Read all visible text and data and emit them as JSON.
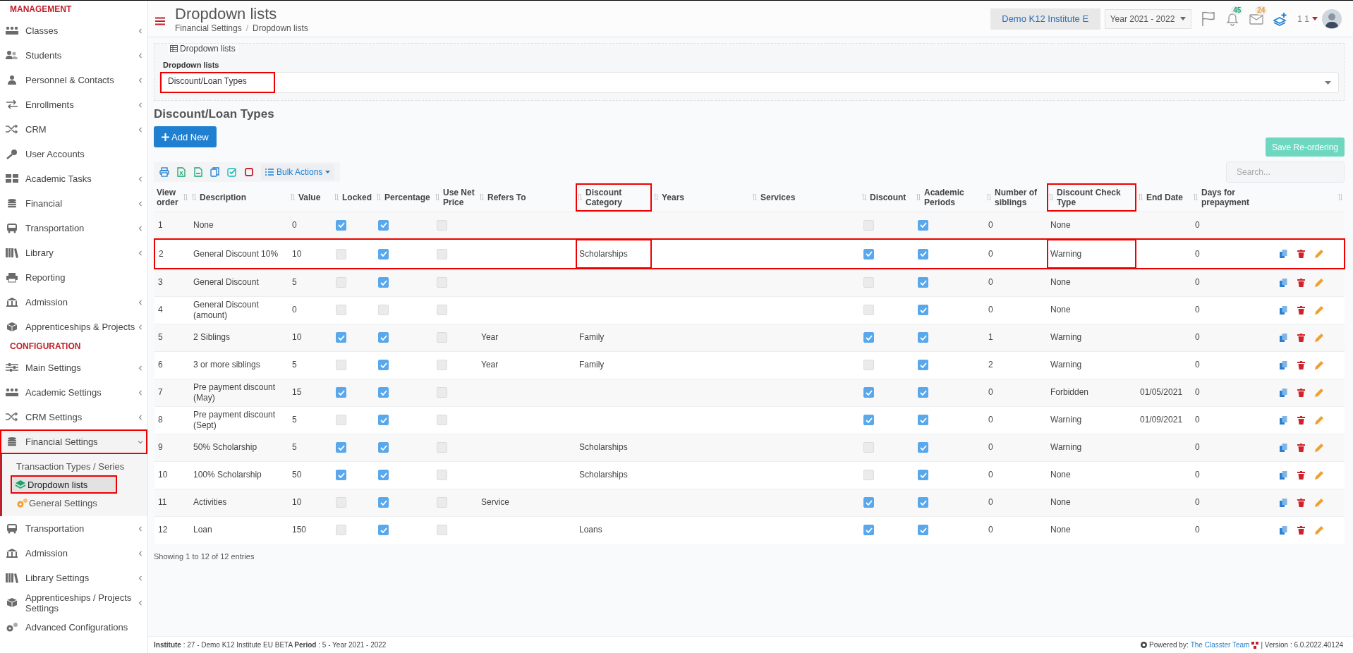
{
  "sidebar": {
    "sections": [
      {
        "heading": "MANAGEMENT",
        "items": [
          {
            "label": "Classes",
            "chevron": true,
            "expanded": false,
            "highlighted": false
          },
          {
            "label": "Students",
            "chevron": true,
            "expanded": false,
            "highlighted": false
          },
          {
            "label": "Personnel & Contacts",
            "chevron": true,
            "expanded": false,
            "highlighted": false
          },
          {
            "label": "Enrollments",
            "chevron": true,
            "expanded": false,
            "highlighted": false
          },
          {
            "label": "CRM",
            "chevron": true,
            "expanded": false,
            "highlighted": false
          },
          {
            "label": "User Accounts",
            "chevron": false,
            "expanded": false,
            "highlighted": false
          },
          {
            "label": "Academic Tasks",
            "chevron": true,
            "expanded": false,
            "highlighted": false
          },
          {
            "label": "Financial",
            "chevron": true,
            "expanded": false,
            "highlighted": false
          },
          {
            "label": "Transportation",
            "chevron": true,
            "expanded": false,
            "highlighted": false
          },
          {
            "label": "Library",
            "chevron": true,
            "expanded": false,
            "highlighted": false
          },
          {
            "label": "Reporting",
            "chevron": false,
            "expanded": false,
            "highlighted": false
          },
          {
            "label": "Admission",
            "chevron": true,
            "expanded": false,
            "highlighted": false
          },
          {
            "label": "Apprenticeships & Projects",
            "chevron": true,
            "expanded": false,
            "highlighted": false
          }
        ]
      },
      {
        "heading": "CONFIGURATION",
        "items": [
          {
            "label": "Main Settings",
            "chevron": true,
            "expanded": false,
            "highlighted": false
          },
          {
            "label": "Academic Settings",
            "chevron": true,
            "expanded": false,
            "highlighted": false
          },
          {
            "label": "CRM Settings",
            "chevron": true,
            "expanded": false,
            "highlighted": false
          },
          {
            "label": "Financial Settings",
            "chevron": true,
            "expanded": true,
            "highlighted": true,
            "children": [
              {
                "label": "Transaction Types / Series",
                "selected": false,
                "highlighted": false
              },
              {
                "label": "Dropdown lists",
                "selected": true,
                "highlighted": true
              },
              {
                "label": "General Settings",
                "selected": false,
                "highlighted": false
              }
            ]
          },
          {
            "label": "Transportation",
            "chevron": true,
            "expanded": false,
            "highlighted": false
          },
          {
            "label": "Admission",
            "chevron": true,
            "expanded": false,
            "highlighted": false
          },
          {
            "label": "Library Settings",
            "chevron": true,
            "expanded": false,
            "highlighted": false
          },
          {
            "label": "Apprenticeships / Projects Settings",
            "chevron": true,
            "expanded": false,
            "highlighted": false
          },
          {
            "label": "Advanced Configurations",
            "chevron": false,
            "expanded": false,
            "highlighted": false
          }
        ]
      }
    ]
  },
  "header": {
    "title": "Dropdown lists",
    "breadcrumb": [
      "Financial Settings",
      "Dropdown lists"
    ],
    "breadcrumb_separator": "/",
    "institute": "Demo K12 Institute E",
    "year": "Year 2021 - 2022",
    "notifications_badge": "45",
    "messages_badge": "24",
    "user": "1 1"
  },
  "panel": {
    "legend": "Dropdown lists",
    "field_label": "Dropdown lists",
    "field_value": "Discount/Loan Types",
    "field_highlighted": true
  },
  "section_title": "Discount/Loan Types",
  "add_button": "Add New",
  "save_button": "Save Re-ordering",
  "bulk_actions": "Bulk Actions",
  "search": {
    "placeholder": "Search..."
  },
  "table": {
    "columns": [
      {
        "label": "View order",
        "highlighted": false
      },
      {
        "label": "Description",
        "highlighted": false
      },
      {
        "label": "Value",
        "highlighted": false
      },
      {
        "label": "Locked",
        "highlighted": false
      },
      {
        "label": "Percentage",
        "highlighted": false
      },
      {
        "label": "Use Net Price",
        "highlighted": false
      },
      {
        "label": "Refers To",
        "highlighted": false
      },
      {
        "label": "Discount Category",
        "highlighted": true
      },
      {
        "label": "Years",
        "highlighted": false
      },
      {
        "label": "Services",
        "highlighted": false
      },
      {
        "label": "Discount",
        "highlighted": false
      },
      {
        "label": "Academic Periods",
        "highlighted": false
      },
      {
        "label": "Number of siblings",
        "highlighted": false
      },
      {
        "label": "Discount Check Type",
        "highlighted": true
      },
      {
        "label": "End Date",
        "highlighted": false
      },
      {
        "label": "Days for prepayment",
        "highlighted": false
      }
    ],
    "rows": [
      {
        "order": "1",
        "description": "None",
        "value": "0",
        "locked": true,
        "percentage": true,
        "use_net_price": false,
        "refers_to": "",
        "category": "",
        "discount": false,
        "academic_periods": true,
        "siblings": "0",
        "check_type": "None",
        "end_date": "",
        "days": "0",
        "actions": false,
        "highlighted": false
      },
      {
        "order": "2",
        "description": "General Discount 10%",
        "value": "10",
        "locked": false,
        "percentage": true,
        "use_net_price": false,
        "refers_to": "",
        "category": "Scholarships",
        "discount": true,
        "academic_periods": true,
        "siblings": "0",
        "check_type": "Warning",
        "end_date": "",
        "days": "0",
        "actions": true,
        "highlighted": true
      },
      {
        "order": "3",
        "description": "General Discount",
        "value": "5",
        "locked": false,
        "percentage": true,
        "use_net_price": false,
        "refers_to": "",
        "category": "",
        "discount": false,
        "academic_periods": true,
        "siblings": "0",
        "check_type": "None",
        "end_date": "",
        "days": "0",
        "actions": true,
        "highlighted": false
      },
      {
        "order": "4",
        "description": "General Discount (amount)",
        "value": "0",
        "locked": false,
        "percentage": false,
        "use_net_price": false,
        "refers_to": "",
        "category": "",
        "discount": false,
        "academic_periods": true,
        "siblings": "0",
        "check_type": "None",
        "end_date": "",
        "days": "0",
        "actions": true,
        "highlighted": false
      },
      {
        "order": "5",
        "description": "2 Siblings",
        "value": "10",
        "locked": true,
        "percentage": true,
        "use_net_price": false,
        "refers_to": "Year",
        "category": "Family",
        "discount": true,
        "academic_periods": true,
        "siblings": "1",
        "check_type": "Warning",
        "end_date": "",
        "days": "0",
        "actions": true,
        "highlighted": false
      },
      {
        "order": "6",
        "description": "3 or more siblings",
        "value": "5",
        "locked": false,
        "percentage": true,
        "use_net_price": false,
        "refers_to": "Year",
        "category": "Family",
        "discount": false,
        "academic_periods": true,
        "siblings": "2",
        "check_type": "Warning",
        "end_date": "",
        "days": "0",
        "actions": true,
        "highlighted": false
      },
      {
        "order": "7",
        "description": "Pre payment discount (May)",
        "value": "15",
        "locked": true,
        "percentage": true,
        "use_net_price": false,
        "refers_to": "",
        "category": "",
        "discount": true,
        "academic_periods": true,
        "siblings": "0",
        "check_type": "Forbidden",
        "end_date": "01/05/2021",
        "days": "0",
        "actions": true,
        "highlighted": false
      },
      {
        "order": "8",
        "description": "Pre payment discount (Sept)",
        "value": "5",
        "locked": false,
        "percentage": true,
        "use_net_price": false,
        "refers_to": "",
        "category": "",
        "discount": true,
        "academic_periods": true,
        "siblings": "0",
        "check_type": "Warning",
        "end_date": "01/09/2021",
        "days": "0",
        "actions": true,
        "highlighted": false
      },
      {
        "order": "9",
        "description": "50% Scholarship",
        "value": "5",
        "locked": true,
        "percentage": true,
        "use_net_price": false,
        "refers_to": "",
        "category": "Scholarships",
        "discount": false,
        "academic_periods": true,
        "siblings": "0",
        "check_type": "Warning",
        "end_date": "",
        "days": "0",
        "actions": true,
        "highlighted": false
      },
      {
        "order": "10",
        "description": "100% Scholarship",
        "value": "50",
        "locked": true,
        "percentage": true,
        "use_net_price": false,
        "refers_to": "",
        "category": "Scholarships",
        "discount": false,
        "academic_periods": true,
        "siblings": "0",
        "check_type": "None",
        "end_date": "",
        "days": "0",
        "actions": true,
        "highlighted": false
      },
      {
        "order": "11",
        "description": "Activities",
        "value": "10",
        "locked": false,
        "percentage": true,
        "use_net_price": false,
        "refers_to": "Service",
        "category": "",
        "discount": true,
        "academic_periods": true,
        "siblings": "0",
        "check_type": "None",
        "end_date": "",
        "days": "0",
        "actions": true,
        "highlighted": false
      },
      {
        "order": "12",
        "description": "Loan",
        "value": "150",
        "locked": false,
        "percentage": true,
        "use_net_price": false,
        "refers_to": "",
        "category": "Loans",
        "discount": true,
        "academic_periods": true,
        "siblings": "0",
        "check_type": "None",
        "end_date": "",
        "days": "0",
        "actions": true,
        "highlighted": false
      }
    ]
  },
  "table_info": "Showing 1 to 12 of 12 entries",
  "footer": {
    "info": "**Institute** : 27 - Demo K12 Institute EU BETA **Period** : 5 - Year 2021 - 2022",
    "powered_by": "Powered by:",
    "team_link": "The Classter Team",
    "version": "| Version : 6.0.2022.40124"
  }
}
